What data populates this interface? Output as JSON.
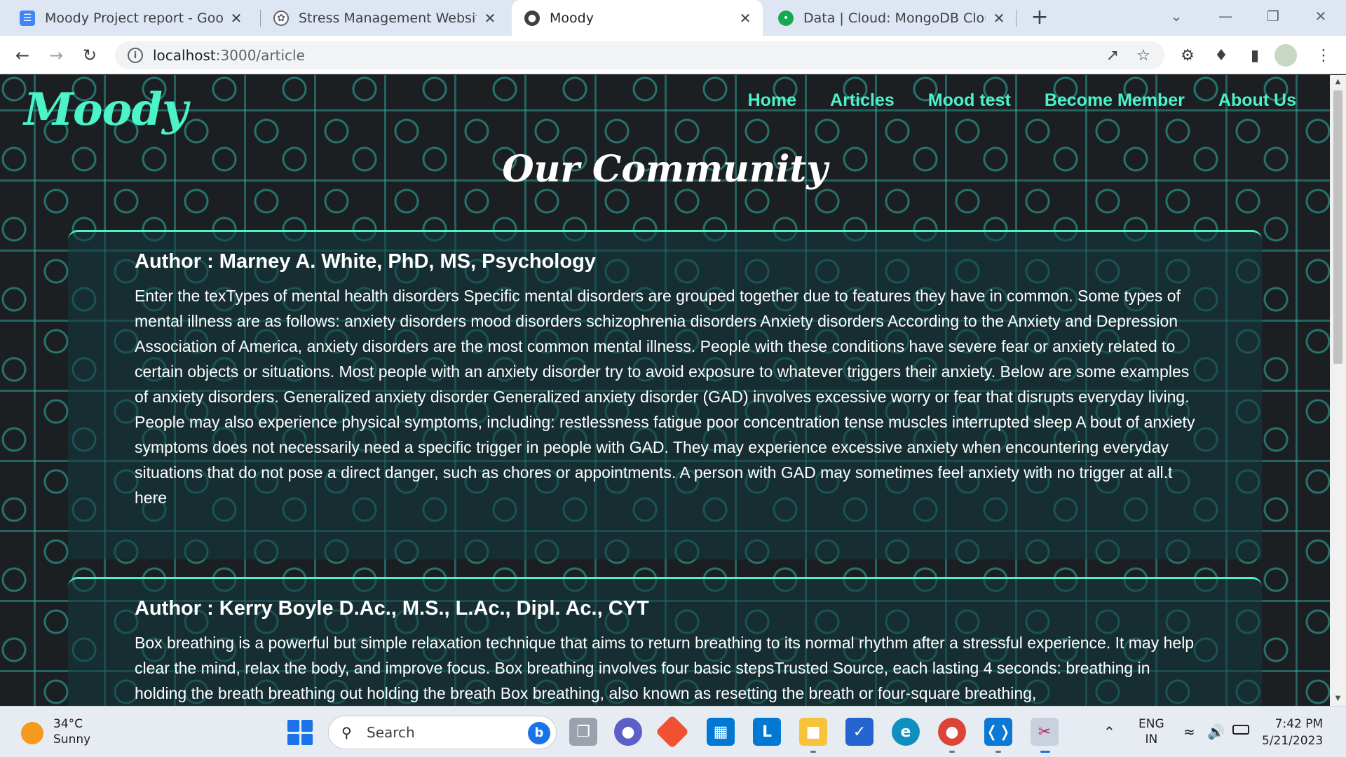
{
  "browser": {
    "tabs": [
      {
        "title": "Moody Project report - Google D",
        "favicon": "docs-icon",
        "color": "#4285f4",
        "active": false
      },
      {
        "title": "Stress Management Website.",
        "favicon": "chatgpt-icon",
        "color": "#5f6368",
        "active": false
      },
      {
        "title": "Moody",
        "favicon": "globe-icon",
        "color": "#3c4043",
        "active": true
      },
      {
        "title": "Data | Cloud: MongoDB Cloud",
        "favicon": "mongodb-icon",
        "color": "#13aa52",
        "active": false
      }
    ],
    "url_host": "localhost",
    "url_path": ":3000/article"
  },
  "site": {
    "logo": "Moody",
    "nav": [
      "Home",
      "Articles",
      "Mood test",
      "Become Member",
      "About Us"
    ],
    "heading": "Our Community",
    "accent_color": "#4cf2c8",
    "articles": [
      {
        "author": "Author : Marney A. White, PhD, MS, Psychology",
        "body": "Enter the texTypes of mental health disorders Specific mental disorders are grouped together due to features they have in common. Some types of mental illness are as follows: anxiety disorders mood disorders schizophrenia disorders Anxiety disorders According to the Anxiety and Depression Association of America, anxiety disorders are the most common mental illness. People with these conditions have severe fear or anxiety related to certain objects or situations. Most people with an anxiety disorder try to avoid exposure to whatever triggers their anxiety. Below are some examples of anxiety disorders. Generalized anxiety disorder Generalized anxiety disorder (GAD) involves excessive worry or fear that disrupts everyday living. People may also experience physical symptoms, including: restlessness fatigue poor concentration tense muscles interrupted sleep A bout of anxiety symptoms does not necessarily need a specific trigger in people with GAD. They may experience excessive anxiety when encountering everyday situations that do not pose a direct danger, such as chores or appointments. A person with GAD may sometimes feel anxiety with no trigger at all.t here"
      },
      {
        "author": "Author : Kerry Boyle D.Ac., M.S., L.Ac., Dipl. Ac., CYT",
        "body": "Box breathing is a powerful but simple relaxation technique that aims to return breathing to its normal rhythm after a stressful experience. It may help clear the mind, relax the body, and improve focus. Box breathing involves four basic stepsTrusted Source, each lasting 4 seconds: breathing in holding the breath breathing out holding the breath Box breathing, also known as resetting the breath or four-square breathing,"
      }
    ]
  },
  "taskbar": {
    "weather_temp": "34°C",
    "weather_desc": "Sunny",
    "search_label": "Search",
    "lang": "ENG",
    "region": "IN",
    "time": "7:42 PM",
    "date": "5/21/2023"
  }
}
